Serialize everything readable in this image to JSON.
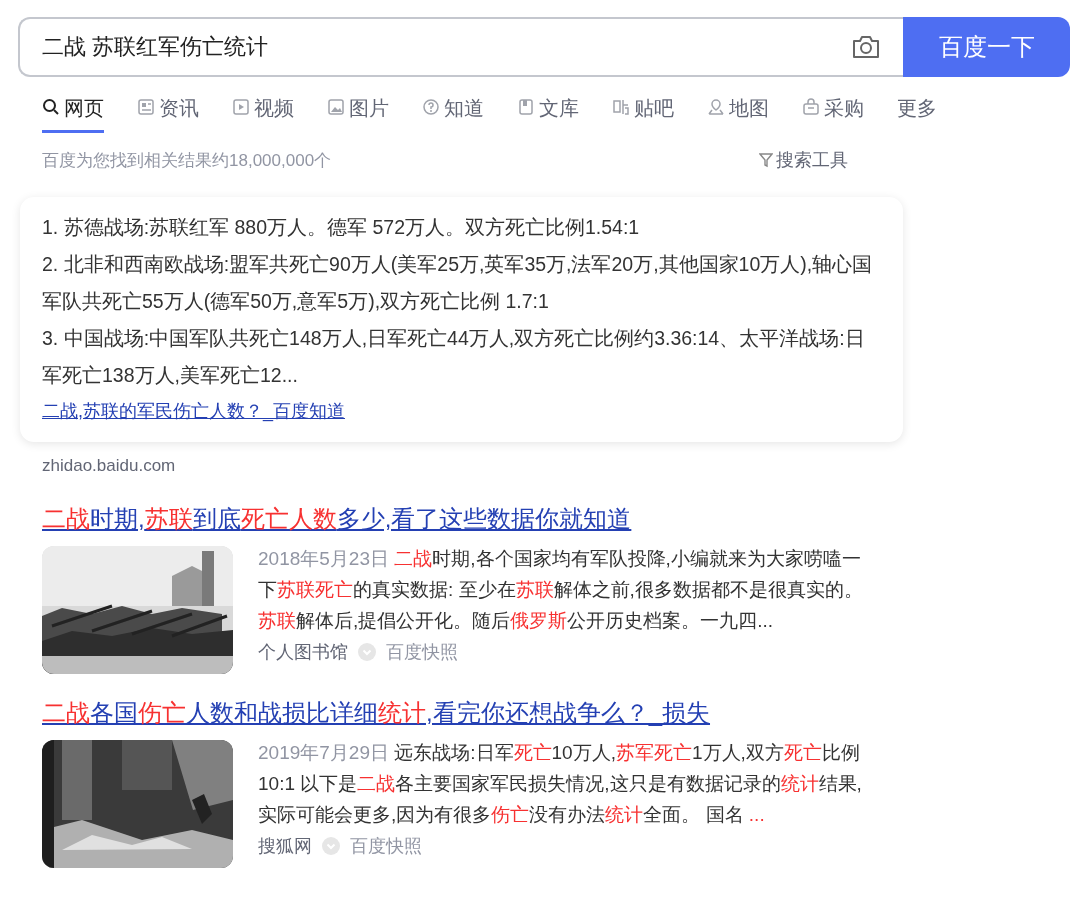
{
  "search": {
    "query": "二战 苏联红军伤亡统计",
    "button": "百度一下"
  },
  "tabs": [
    {
      "label": "网页",
      "selected": true
    },
    {
      "label": "资讯",
      "selected": false
    },
    {
      "label": "视频",
      "selected": false
    },
    {
      "label": "图片",
      "selected": false
    },
    {
      "label": "知道",
      "selected": false
    },
    {
      "label": "文库",
      "selected": false
    },
    {
      "label": "贴吧",
      "selected": false
    },
    {
      "label": "地图",
      "selected": false
    },
    {
      "label": "采购",
      "selected": false
    },
    {
      "label": "更多",
      "selected": false
    }
  ],
  "result_count": "百度为您找到相关结果约18,000,000个",
  "search_tools": "搜索工具",
  "answer_card": {
    "lines": [
      "1. 苏德战场:苏联红军 880万人。德军 572万人。双方死亡比例1.54:1",
      "2. 北非和西南欧战场:盟军共死亡90万人(美军25万,英军35万,法军20万,其他国家10万人),轴心国军队共死亡55万人(德军50万,意军5万),双方死亡比例 1.7:1",
      "3. 中国战场:中国军队共死亡148万人,日军死亡44万人,双方死亡比例约3.36:14、太平洋战场:日军死亡138万人,美军死亡12..."
    ],
    "link": "二战,苏联的军民伤亡人数？_百度知道",
    "source": "zhidao.baidu.com"
  },
  "results": [
    {
      "title": [
        {
          "text": "二战",
          "highlight": true
        },
        {
          "text": "时期,",
          "highlight": false
        },
        {
          "text": "苏联",
          "highlight": true
        },
        {
          "text": "到底",
          "highlight": false
        },
        {
          "text": "死亡人数",
          "highlight": true
        },
        {
          "text": "多少,看了这些数据你就知道",
          "highlight": false
        }
      ],
      "date": "2018年5月23日",
      "snippet": [
        {
          "text": "二战",
          "highlight": true
        },
        {
          "text": "时期,各个国家均有军队投降,小编就来为大家唠嗑一下",
          "highlight": false
        },
        {
          "text": "苏联死亡",
          "highlight": true
        },
        {
          "text": "的真实数据: 至少在",
          "highlight": false
        },
        {
          "text": "苏联",
          "highlight": true
        },
        {
          "text": "解体之前,很多数据都不是很真实的。",
          "highlight": false
        },
        {
          "text": "苏联",
          "highlight": true
        },
        {
          "text": "解体后,提倡公开化。随后",
          "highlight": false
        },
        {
          "text": "俄罗斯",
          "highlight": true
        },
        {
          "text": "公开历史档案。一九四...",
          "highlight": false
        }
      ],
      "source": "个人图书馆",
      "snapshot": "百度快照"
    },
    {
      "title": [
        {
          "text": "二战",
          "highlight": true
        },
        {
          "text": "各国",
          "highlight": false
        },
        {
          "text": "伤亡",
          "highlight": true
        },
        {
          "text": "人数和战损比详细",
          "highlight": false
        },
        {
          "text": "统计",
          "highlight": true
        },
        {
          "text": ",看完你还想战争么？_损失",
          "highlight": false
        }
      ],
      "date": "2019年7月29日",
      "snippet": [
        {
          "text": "远东战场:日军",
          "highlight": false
        },
        {
          "text": "死亡",
          "highlight": true
        },
        {
          "text": "10万人,",
          "highlight": false
        },
        {
          "text": "苏军死亡",
          "highlight": true
        },
        {
          "text": "1万人,双方",
          "highlight": false
        },
        {
          "text": "死亡",
          "highlight": true
        },
        {
          "text": "比例10:1 以下是",
          "highlight": false
        },
        {
          "text": "二战",
          "highlight": true
        },
        {
          "text": "各主要国家军民损失情况,这只是有数据记录的",
          "highlight": false
        },
        {
          "text": "统计",
          "highlight": true
        },
        {
          "text": "结果,实际可能会更多,因为有很多",
          "highlight": false
        },
        {
          "text": "伤亡",
          "highlight": true
        },
        {
          "text": "没有办法",
          "highlight": false
        },
        {
          "text": "统计",
          "highlight": true
        },
        {
          "text": "全面。 国名 ",
          "highlight": false
        },
        {
          "text": "...",
          "highlight": true
        }
      ],
      "source": "搜狐网",
      "snapshot": "百度快照"
    }
  ]
}
